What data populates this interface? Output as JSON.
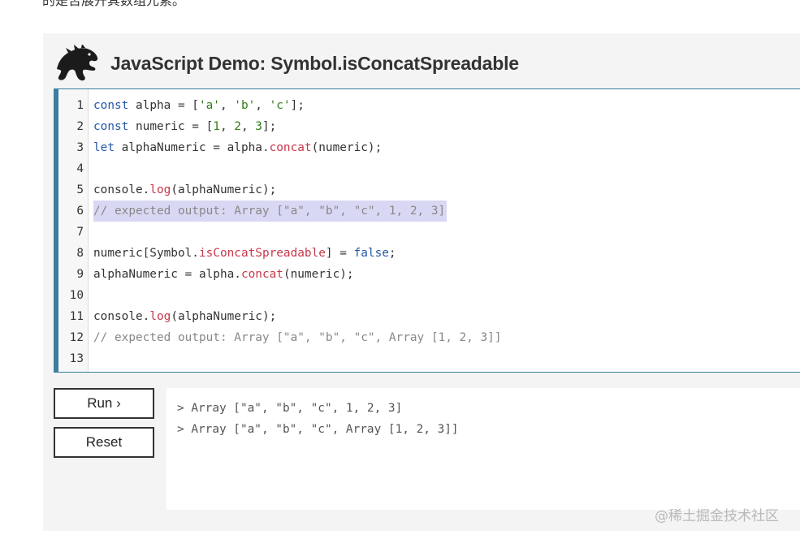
{
  "page": {
    "intro_text": "的是否展开其数组元素。"
  },
  "demo": {
    "title": "JavaScript Demo: Symbol.isConcatSpreadable",
    "logo_icon": "dinosaur-logo-icon",
    "code_lines": [
      {
        "n": "1",
        "tokens": [
          [
            "kw",
            "const"
          ],
          [
            "t",
            " alpha = ["
          ],
          [
            "str",
            "'a'"
          ],
          [
            "t",
            ", "
          ],
          [
            "str",
            "'b'"
          ],
          [
            "t",
            ", "
          ],
          [
            "str",
            "'c'"
          ],
          [
            "t",
            "];"
          ]
        ]
      },
      {
        "n": "2",
        "tokens": [
          [
            "kw",
            "const"
          ],
          [
            "t",
            " numeric = ["
          ],
          [
            "num",
            "1"
          ],
          [
            "t",
            ", "
          ],
          [
            "num",
            "2"
          ],
          [
            "t",
            ", "
          ],
          [
            "num",
            "3"
          ],
          [
            "t",
            "];"
          ]
        ]
      },
      {
        "n": "3",
        "tokens": [
          [
            "kw",
            "let"
          ],
          [
            "t",
            " alphaNumeric = alpha."
          ],
          [
            "fn",
            "concat"
          ],
          [
            "t",
            "(numeric);"
          ]
        ]
      },
      {
        "n": "4",
        "tokens": []
      },
      {
        "n": "5",
        "tokens": [
          [
            "t",
            "console."
          ],
          [
            "fn",
            "log"
          ],
          [
            "t",
            "(alphaNumeric);"
          ]
        ]
      },
      {
        "n": "6",
        "highlight": true,
        "tokens": [
          [
            "cm",
            "// expected output: Array [\"a\", \"b\", \"c\", 1, 2, 3]"
          ]
        ]
      },
      {
        "n": "7",
        "tokens": []
      },
      {
        "n": "8",
        "tokens": [
          [
            "t",
            "numeric[Symbol."
          ],
          [
            "fn",
            "isConcatSpreadable"
          ],
          [
            "t",
            "] = "
          ],
          [
            "kw",
            "false"
          ],
          [
            "t",
            ";"
          ]
        ]
      },
      {
        "n": "9",
        "tokens": [
          [
            "t",
            "alphaNumeric = alpha."
          ],
          [
            "fn",
            "concat"
          ],
          [
            "t",
            "(numeric);"
          ]
        ]
      },
      {
        "n": "10",
        "tokens": []
      },
      {
        "n": "11",
        "tokens": [
          [
            "t",
            "console."
          ],
          [
            "fn",
            "log"
          ],
          [
            "t",
            "(alphaNumeric);"
          ]
        ]
      },
      {
        "n": "12",
        "tokens": [
          [
            "cm",
            "// expected output: Array [\"a\", \"b\", \"c\", Array [1, 2, 3]]"
          ]
        ]
      },
      {
        "n": "13",
        "tokens": []
      }
    ],
    "run_label": "Run ›",
    "reset_label": "Reset",
    "console_lines": [
      "> Array [\"a\", \"b\", \"c\", 1, 2, 3]",
      "> Array [\"a\", \"b\", \"c\", Array [1, 2, 3]]"
    ]
  },
  "watermark": "@稀土掘金技术社区",
  "colors": {
    "accent_border": "#3a7ea1",
    "keyword": "#2457a8",
    "string": "#2e7d17",
    "function": "#c8384a",
    "comment": "#888888",
    "highlight": "#d8d8f4"
  }
}
